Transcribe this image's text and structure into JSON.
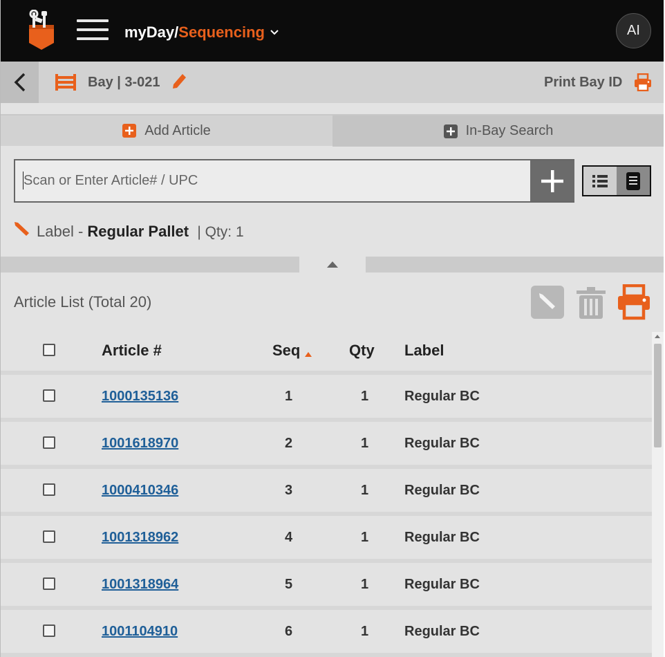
{
  "header": {
    "app_name": "myDay/",
    "module_name": "Sequencing",
    "user_initials": "AI"
  },
  "bay": {
    "label": "Bay | 3-021",
    "print_label": "Print Bay ID"
  },
  "tabs": [
    {
      "label": "Add Article",
      "active": true
    },
    {
      "label": "In-Bay Search",
      "active": false
    }
  ],
  "scan": {
    "placeholder": "Scan or Enter Article# / UPC",
    "value": ""
  },
  "label_info": {
    "prefix": "Label - ",
    "name": "Regular Pallet",
    "qty_text": "| Qty: 1"
  },
  "article_list": {
    "title": "Article List (Total 20)",
    "columns": {
      "article": "Article #",
      "seq": "Seq",
      "qty": "Qty",
      "label": "Label"
    },
    "rows": [
      {
        "article": "1000135136",
        "seq": "1",
        "qty": "1",
        "label": "Regular BC"
      },
      {
        "article": "1001618970",
        "seq": "2",
        "qty": "1",
        "label": "Regular BC"
      },
      {
        "article": "1000410346",
        "seq": "3",
        "qty": "1",
        "label": "Regular BC"
      },
      {
        "article": "1001318962",
        "seq": "4",
        "qty": "1",
        "label": "Regular BC"
      },
      {
        "article": "1001318964",
        "seq": "5",
        "qty": "1",
        "label": "Regular BC"
      },
      {
        "article": "1001104910",
        "seq": "6",
        "qty": "1",
        "label": "Regular BC"
      }
    ]
  },
  "colors": {
    "accent": "#e8601c",
    "link": "#1f5f98",
    "header_bg": "#0c0c0c"
  }
}
